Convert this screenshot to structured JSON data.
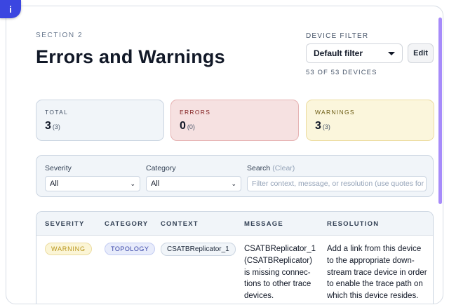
{
  "info_badge": "i",
  "header": {
    "section_label": "SECTION 2",
    "title": "Errors and Warnings"
  },
  "device_filter": {
    "label": "DEVICE FILTER",
    "selected": "Default filter",
    "edit_label": "Edit",
    "count_text": "53 OF 53 DEVICES"
  },
  "stats": {
    "total": {
      "label": "TOTAL",
      "value": "3",
      "sub": "(3)"
    },
    "errors": {
      "label": "ERRORS",
      "value": "0",
      "sub": "(0)"
    },
    "warnings": {
      "label": "WARNINGS",
      "value": "3",
      "sub": "(3)"
    }
  },
  "filters": {
    "severity_label": "Severity",
    "severity_value": "All",
    "category_label": "Category",
    "category_value": "All",
    "search_label": "Search",
    "search_clear": "(Clear)",
    "search_placeholder": "Filter context, message, or resolution (use quotes for exac"
  },
  "table": {
    "columns": [
      "SEVERITY",
      "CATEGORY",
      "CONTEXT",
      "MESSAGE",
      "RESOLUTION"
    ],
    "rows": [
      {
        "severity": "WARNING",
        "category": "TOPOLOGY",
        "context": "CSATBReplicator_1",
        "message_lines": [
          "CSATBReplicator_1",
          "(CSATBReplicator)",
          "is missing connec-",
          "tions to other trace",
          "devices."
        ],
        "resolution_lines": [
          "Add a link from this device",
          "to the appropriate down-",
          "stream trace device in order",
          "to enable the trace path on",
          "which this device resides."
        ]
      }
    ]
  },
  "colors": {
    "accent": "#3b46e0",
    "scrollbar": "#a78bfa",
    "error_bg": "#f6e1e1",
    "warning_bg": "#fbf6dc"
  }
}
